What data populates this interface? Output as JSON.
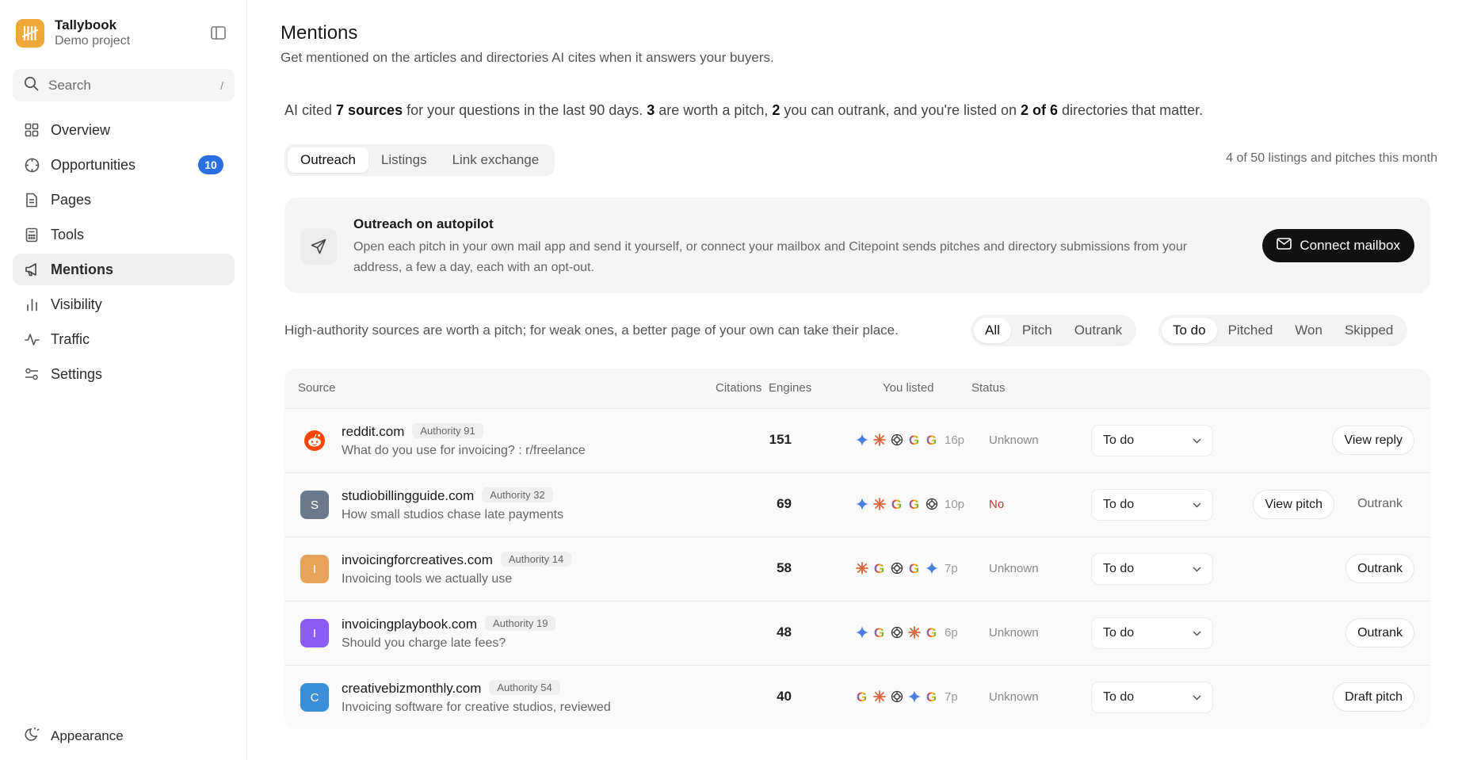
{
  "app": {
    "name": "Tallybook",
    "project": "Demo project"
  },
  "search": {
    "label": "Search",
    "shortcut": "/"
  },
  "nav": [
    {
      "label": "Overview",
      "icon": "grid-icon"
    },
    {
      "label": "Opportunities",
      "icon": "target-icon",
      "badge": "10"
    },
    {
      "label": "Pages",
      "icon": "page-icon"
    },
    {
      "label": "Tools",
      "icon": "calculator-icon"
    },
    {
      "label": "Mentions",
      "icon": "megaphone-icon",
      "active": true
    },
    {
      "label": "Visibility",
      "icon": "bar-chart-icon"
    },
    {
      "label": "Traffic",
      "icon": "pulse-icon"
    },
    {
      "label": "Settings",
      "icon": "sliders-icon"
    }
  ],
  "appearance_label": "Appearance",
  "page": {
    "title": "Mentions",
    "subtitle": "Get mentioned on the articles and directories AI cites when it answers your buyers."
  },
  "summary": {
    "p1": "AI cited ",
    "b1": "7 sources",
    "p2": " for your questions in the last 90 days. ",
    "b2": "3",
    "p3": " are worth a pitch, ",
    "b3": "2",
    "p4": " you can outrank, and you're listed on ",
    "b4": "2 of 6",
    "p5": " directories that matter."
  },
  "tabs": [
    "Outreach",
    "Listings",
    "Link exchange"
  ],
  "quota": "4 of 50 listings and pitches this month",
  "autopilot": {
    "title": "Outreach on autopilot",
    "description": "Open each pitch in your own mail app and send it yourself, or connect your mailbox and Citepoint sends pitches and directory submissions from your address, a few a day, each with an opt-out.",
    "button": "Connect mailbox"
  },
  "hint": "High-authority sources are worth a pitch; for weak ones, a better page of your own can take their place.",
  "type_filters": [
    "All",
    "Pitch",
    "Outrank"
  ],
  "status_filters": [
    "To do",
    "Pitched",
    "Won",
    "Skipped"
  ],
  "table": {
    "headers": {
      "source": "Source",
      "citations": "Citations",
      "engines": "Engines",
      "listed": "You listed",
      "status": "Status"
    },
    "rows": [
      {
        "domain": "reddit.com",
        "authority": "Authority 91",
        "title": "What do you use for invoicing? : r/freelance",
        "favicon_letter": "",
        "favicon_color": "#ffffff",
        "citations": "151",
        "engines": [
          "gemini",
          "claude",
          "openai",
          "google",
          "google"
        ],
        "engines_more": "16p",
        "listed": "Unknown",
        "status": "To do",
        "primary_action": "View reply",
        "secondary_action": ""
      },
      {
        "domain": "studiobillingguide.com",
        "authority": "Authority 32",
        "title": "How small studios chase late payments",
        "favicon_letter": "S",
        "favicon_color": "#6b7a8c",
        "citations": "69",
        "engines": [
          "gemini",
          "claude",
          "google",
          "google",
          "openai"
        ],
        "engines_more": "10p",
        "listed": "No",
        "status": "To do",
        "primary_action": "View pitch",
        "secondary_action": "Outrank"
      },
      {
        "domain": "invoicingforcreatives.com",
        "authority": "Authority 14",
        "title": "Invoicing tools we actually use",
        "favicon_letter": "I",
        "favicon_color": "#e9a25a",
        "citations": "58",
        "engines": [
          "claude",
          "google",
          "openai",
          "google",
          "gemini"
        ],
        "engines_more": "7p",
        "listed": "Unknown",
        "status": "To do",
        "primary_action": "Outrank",
        "secondary_action": ""
      },
      {
        "domain": "invoicingplaybook.com",
        "authority": "Authority 19",
        "title": "Should you charge late fees?",
        "favicon_letter": "I",
        "favicon_color": "#8b5cf6",
        "citations": "48",
        "engines": [
          "gemini",
          "google",
          "openai",
          "claude",
          "google"
        ],
        "engines_more": "6p",
        "listed": "Unknown",
        "status": "To do",
        "primary_action": "Outrank",
        "secondary_action": ""
      },
      {
        "domain": "creativebizmonthly.com",
        "authority": "Authority 54",
        "title": "Invoicing software for creative studios, reviewed",
        "favicon_letter": "C",
        "favicon_color": "#3b8fd9",
        "citations": "40",
        "engines": [
          "google",
          "claude",
          "openai",
          "gemini",
          "google"
        ],
        "engines_more": "7p",
        "listed": "Unknown",
        "status": "To do",
        "primary_action": "Draft pitch",
        "secondary_action": ""
      }
    ]
  },
  "colors": {
    "brand": "#f0a73a",
    "badge": "#2b6fe0",
    "danger": "#c0392b",
    "reddit": "#ff4500"
  }
}
